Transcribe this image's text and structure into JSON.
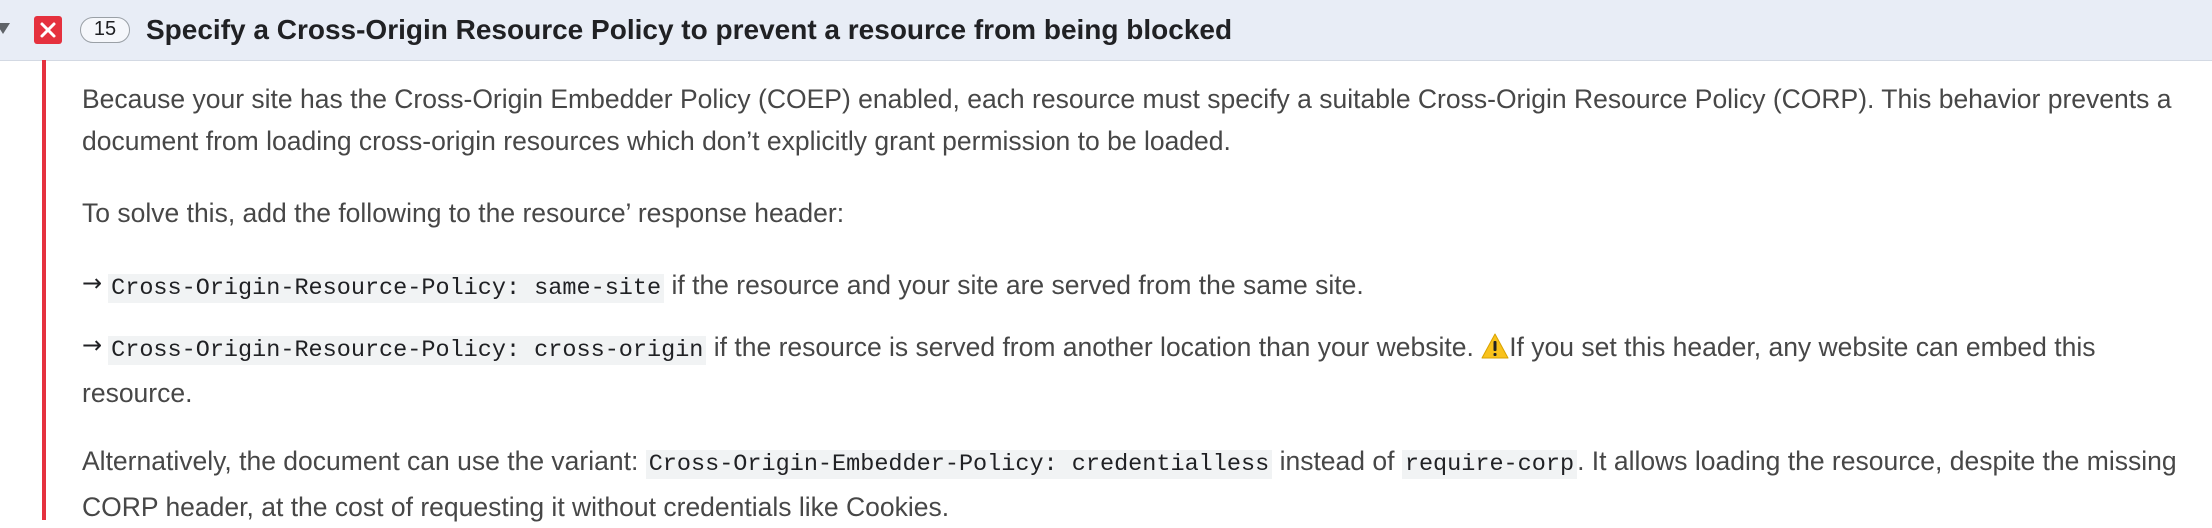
{
  "issue": {
    "count": "15",
    "title": "Specify a Cross-Origin Resource Policy to prevent a resource from being blocked",
    "accent_color": "#e5313e",
    "icons": [
      "disclosure-triangle-icon",
      "error-x-icon",
      "arrow-right-icon",
      "warning-icon"
    ]
  },
  "body": {
    "intro": "Because your site has the Cross-Origin Embedder Policy (COEP) enabled, each resource must specify a suitable Cross-Origin Resource Policy (CORP). This behavior prevents a document from loading cross-origin resources which don’t explicitly grant permission to be loaded.",
    "solve": "To solve this, add the following to the resource’ response header:",
    "option1": {
      "arrow": "→",
      "code": "Cross-Origin-Resource-Policy: same-site",
      "text": " if the resource and your site are served from the same site."
    },
    "option2": {
      "arrow": "→",
      "code": "Cross-Origin-Resource-Policy: cross-origin",
      "text": " if the resource is served from another location than your website. ",
      "warning": "If you set this header, any website can embed this resource."
    },
    "alternative": {
      "text1": "Alternatively, the document can use the variant: ",
      "code1": "Cross-Origin-Embedder-Policy: credentialless",
      "text2": " instead of ",
      "code2": "require-corp",
      "text3": ". It allows loading the resource, despite the missing CORP header, at the cost of requesting it without credentials like Cookies."
    }
  }
}
